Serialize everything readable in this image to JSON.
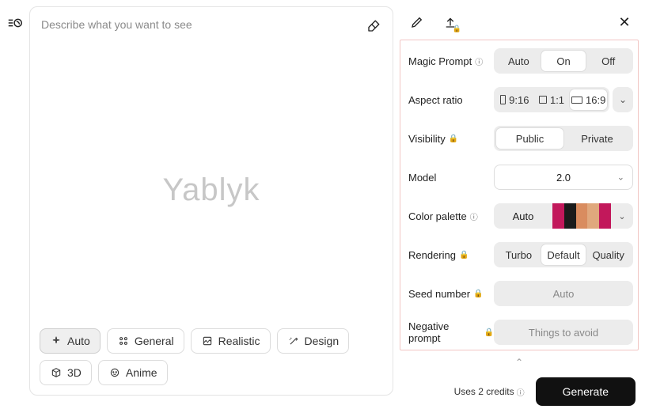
{
  "prompt": {
    "placeholder": "Describe what you want to see",
    "value": ""
  },
  "watermark": "Yablyk",
  "styles": [
    {
      "id": "auto",
      "label": "Auto",
      "active": true
    },
    {
      "id": "general",
      "label": "General",
      "active": false
    },
    {
      "id": "realistic",
      "label": "Realistic",
      "active": false
    },
    {
      "id": "design",
      "label": "Design",
      "active": false
    },
    {
      "id": "3d",
      "label": "3D",
      "active": false
    },
    {
      "id": "anime",
      "label": "Anime",
      "active": false
    }
  ],
  "settings": {
    "magic_prompt": {
      "label": "Magic Prompt",
      "options": [
        "Auto",
        "On",
        "Off"
      ],
      "selected": "On"
    },
    "aspect_ratio": {
      "label": "Aspect ratio",
      "options": [
        "9:16",
        "1:1",
        "16:9"
      ],
      "selected": "16:9"
    },
    "visibility": {
      "label": "Visibility",
      "options": [
        "Public",
        "Private"
      ],
      "selected": "Public"
    },
    "model": {
      "label": "Model",
      "selected": "2.0"
    },
    "color_palette": {
      "label": "Color palette",
      "auto_label": "Auto",
      "colors": [
        "#c2185b",
        "#1b1b1b",
        "#d98c5f",
        "#e0a87d",
        "#c2185b"
      ]
    },
    "rendering": {
      "label": "Rendering",
      "options": [
        "Turbo",
        "Default",
        "Quality"
      ],
      "selected": "Default"
    },
    "seed": {
      "label": "Seed number",
      "placeholder": "Auto",
      "value": ""
    },
    "negative": {
      "label": "Negative prompt",
      "placeholder": "Things to avoid",
      "value": ""
    }
  },
  "footer": {
    "credits_text": "Uses 2 credits",
    "generate_label": "Generate"
  }
}
